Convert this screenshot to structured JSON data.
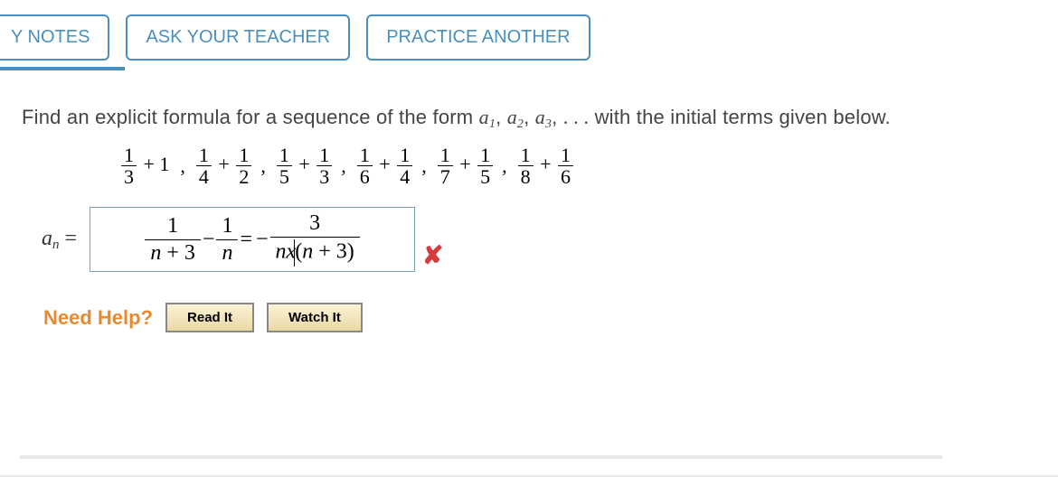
{
  "buttons": {
    "my_notes": "Y NOTES",
    "ask_teacher": "ASK YOUR TEACHER",
    "practice_another": "PRACTICE ANOTHER"
  },
  "prompt": {
    "prefix": "Find an explicit formula for a sequence of the form ",
    "a": "a",
    "sub1": "1",
    "sub2": "2",
    "sub3": "3",
    "comma": ", ",
    "dots": ". . .",
    "suffix": " with the initial terms given below."
  },
  "sequence": {
    "terms": [
      {
        "parts": [
          {
            "frac": [
              "1",
              "3"
            ]
          },
          {
            "text": " + 1"
          }
        ]
      },
      {
        "parts": [
          {
            "frac": [
              "1",
              "4"
            ]
          },
          {
            "text": " + "
          },
          {
            "frac": [
              "1",
              "2"
            ]
          }
        ]
      },
      {
        "parts": [
          {
            "frac": [
              "1",
              "5"
            ]
          },
          {
            "text": " + "
          },
          {
            "frac": [
              "1",
              "3"
            ]
          }
        ]
      },
      {
        "parts": [
          {
            "frac": [
              "1",
              "6"
            ]
          },
          {
            "text": " + "
          },
          {
            "frac": [
              "1",
              "4"
            ]
          }
        ]
      },
      {
        "parts": [
          {
            "frac": [
              "1",
              "7"
            ]
          },
          {
            "text": " + "
          },
          {
            "frac": [
              "1",
              "5"
            ]
          }
        ]
      },
      {
        "parts": [
          {
            "frac": [
              "1",
              "8"
            ]
          },
          {
            "text": " + "
          },
          {
            "frac": [
              "1",
              "6"
            ]
          }
        ]
      }
    ]
  },
  "answer": {
    "label_a": "a",
    "label_n": "n",
    "equals": " = ",
    "entered": {
      "f1_num": "1",
      "f1_den_l": "n",
      "f1_den_plus": " + ",
      "f1_den_r": "3",
      "minus1": " − ",
      "f2_num": "1",
      "f2_den": "n",
      "eq": " = ",
      "neg": "− ",
      "f3_num": "3",
      "f3_den_l": "n",
      "f3_den_x": "x",
      "f3_den_lp": "(",
      "f3_den_n": "n",
      "f3_den_plus": " + ",
      "f3_den_3": "3",
      "f3_den_rp": ")"
    },
    "status": "incorrect"
  },
  "help": {
    "label": "Need Help?",
    "read_it": "Read It",
    "watch_it": "Watch It"
  }
}
